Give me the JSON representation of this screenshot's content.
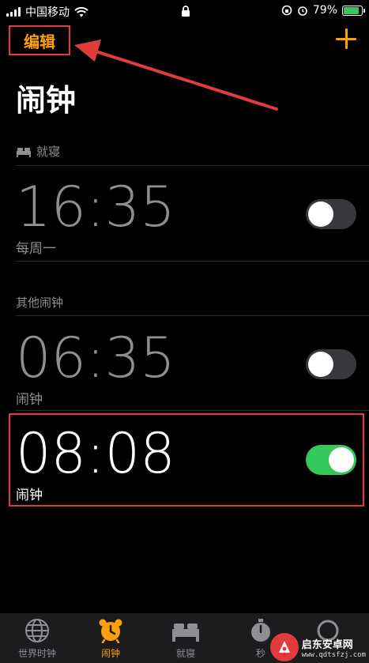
{
  "status_bar": {
    "carrier": "中国移动",
    "battery": "79%"
  },
  "nav": {
    "edit_label": "编辑"
  },
  "title": "闹钟",
  "sections": {
    "bedtime": "就寝",
    "other": "其他闹钟"
  },
  "alarms": [
    {
      "time": "16:35",
      "label": "每周一",
      "enabled": false
    },
    {
      "time": "06:35",
      "label": "闹钟",
      "enabled": false
    },
    {
      "time": "08:08",
      "label": "闹钟",
      "enabled": true
    }
  ],
  "tabs": [
    {
      "label": "世界时钟",
      "icon": "globe-icon",
      "active": false
    },
    {
      "label": "闹钟",
      "icon": "alarm-clock-icon",
      "active": true
    },
    {
      "label": "就寝",
      "icon": "bed-icon",
      "active": false
    },
    {
      "label": "秒",
      "icon": "stopwatch-icon",
      "active": false
    },
    {
      "label": "",
      "icon": "timer-icon",
      "active": false
    }
  ],
  "watermark": {
    "name": "启东安卓网",
    "url": "www.qdtsfzj.com"
  },
  "colors": {
    "accent": "#ff9f0a",
    "toggle_on": "#34c759",
    "annotation": "#e23b3b"
  }
}
